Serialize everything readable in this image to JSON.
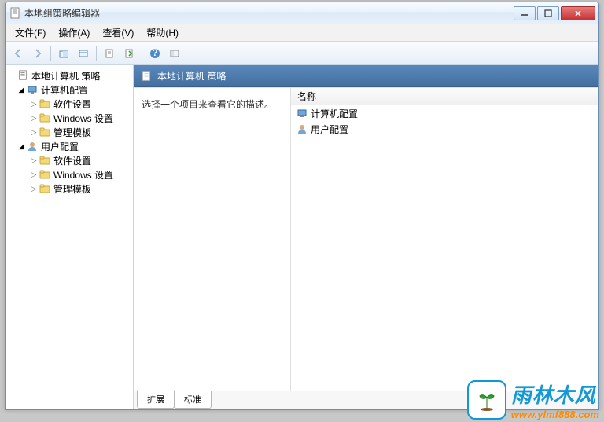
{
  "window": {
    "title": "本地组策略编辑器"
  },
  "menu": {
    "file": "文件(F)",
    "action": "操作(A)",
    "view": "查看(V)",
    "help": "帮助(H)"
  },
  "tree": {
    "root": "本地计算机 策略",
    "computer": "计算机配置",
    "user": "用户配置",
    "software": "软件设置",
    "windows": "Windows 设置",
    "admin": "管理模板"
  },
  "right": {
    "header": "本地计算机 策略",
    "description": "选择一个项目来查看它的描述。",
    "colName": "名称",
    "items": {
      "computer": "计算机配置",
      "user": "用户配置"
    }
  },
  "tabs": {
    "extended": "扩展",
    "standard": "标准"
  },
  "watermark": {
    "brand": "雨林木风",
    "url": "www.ylmf888.com"
  }
}
